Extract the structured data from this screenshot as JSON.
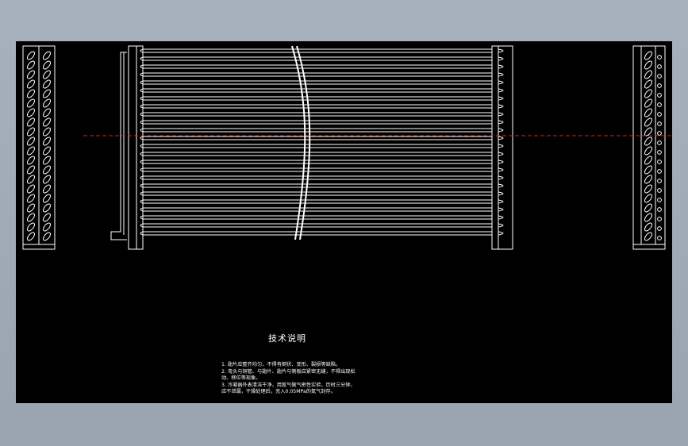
{
  "drawing": {
    "background": "#000000",
    "window_background": "#9aa4b1",
    "line_color": "#ffffff",
    "centerline_color": "#d22424",
    "left_end_view": {
      "hole_count": 20
    },
    "main_view": {
      "tube_count": 24
    },
    "right_end_view": {
      "hole_count": 20,
      "bolt_count": 20
    }
  },
  "notes": {
    "title": "技术说明",
    "lines": [
      "1. 翅片应整齐均匀，不得有倒伏、变形、裂损等缺陷。",
      "2. 弯头与铜管、与翅片、翅片与侧板应紧密无缝，不得出现松",
      "   动、移位等现象。",
      "3. 冷凝器外表清洁干净，用氮气做气密性实验，历时三分钟，",
      "   应不泄漏，干燥处理后，充入0.05MPa的氮气封存。"
    ]
  }
}
